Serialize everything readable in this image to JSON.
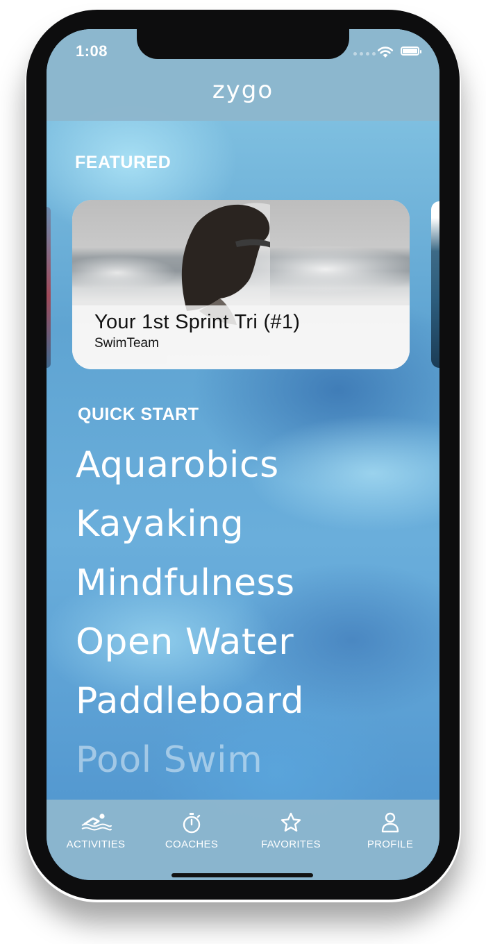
{
  "status_bar": {
    "time": "1:08"
  },
  "header": {
    "logo": "zygo"
  },
  "featured": {
    "title": "FEATURED",
    "card": {
      "title": "Your 1st Sprint Tri (#1)",
      "subtitle": "SwimTeam"
    }
  },
  "quick_start": {
    "title": "QUICK START",
    "items": [
      "Aquarobics",
      "Kayaking",
      "Mindfulness",
      "Open Water",
      "Paddleboard",
      "Pool Swim"
    ]
  },
  "tab_bar": {
    "items": [
      {
        "label": "ACTIVITIES",
        "icon": "swimmer-icon"
      },
      {
        "label": "COACHES",
        "icon": "stopwatch-icon"
      },
      {
        "label": "FAVORITES",
        "icon": "star-icon"
      },
      {
        "label": "PROFILE",
        "icon": "person-icon"
      }
    ]
  },
  "colors": {
    "header_bg": "#8cb6cd",
    "accent_white": "#ffffff",
    "background_blue": "#5d9dcc"
  }
}
